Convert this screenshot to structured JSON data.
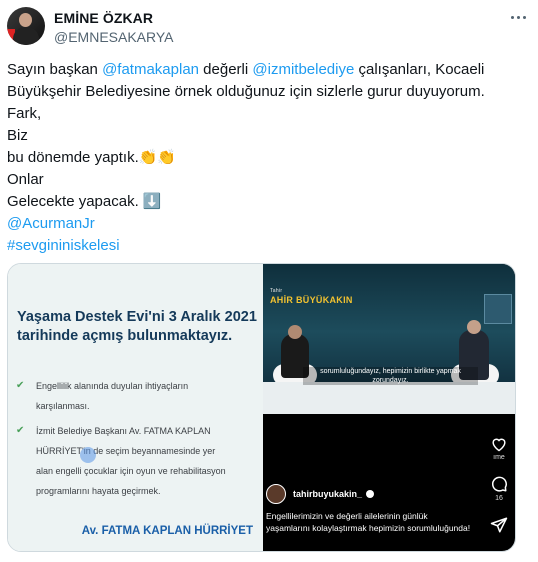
{
  "author": {
    "name": "EMİNE ÖZKAR",
    "handle": "@EMNESAKARYA"
  },
  "tweet": {
    "line1_pre": "Sayın başkan ",
    "line1_mention1": "@fatmakaplan",
    "line1_mid": " değerli ",
    "line1_mention2": "@izmitbelediye",
    "line1_post": " çalışanları, Kocaeli",
    "line2": "Büyükşehir Belediyesine örnek olduğunuz için sizlerle gurur duyuyorum.",
    "line3": "Fark,",
    "line4": "Biz",
    "line5": "bu dönemde yaptık.👏👏",
    "line6": "Onlar",
    "line7": "Gelecekte yapacak. ⬇️",
    "mention3": "@AcurmanJr",
    "hashtag": "#sevgininiskelesi"
  },
  "media_left": {
    "headline": "Yaşama Destek Evi'ni 3 Aralık 2021 tarihinde açmış bulunmaktayız.",
    "bullet1_l1": "Engellilik alanında duyulan ihtiyaçların",
    "bullet1_l2": "karşılanması.",
    "bullet2_l1": "İzmit Belediye Başkanı Av. FATMA KAPLAN",
    "bullet2_l2": "HÜRRİYET'in de seçim beyannamesinde yer",
    "bullet2_l3": "alan engelli çocuklar için oyun ve rehabilitasyon",
    "bullet2_l4": "programlarını hayata geçirmek.",
    "signature": "Av. FATMA KAPLAN HÜRRİYET"
  },
  "media_right": {
    "brand_small": "Tahir",
    "brand": "AHİR BÜYÜKAKIN",
    "video_caption": "sorumluluğundayız, hepimizin birlikte yapmak zorundayız.",
    "like_count": "ıme",
    "comment_count": "16",
    "username": "tahirbuyukakin_",
    "caption": "Engellilerimizin ve değerli ailelerinin günlük yaşamlarını kolaylaştırmak hepimizin sorumluluğunda!"
  },
  "colors": {
    "accent": "#1d9bf0",
    "headline": "#153a5a",
    "signature": "#1a5fa8",
    "check": "#4aa05a"
  }
}
